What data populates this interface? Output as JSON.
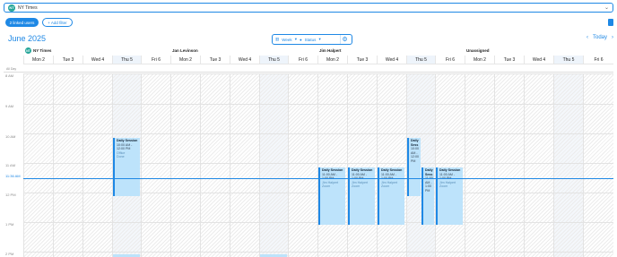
{
  "topbar": {
    "avatar": "NT",
    "label": "NY Times"
  },
  "toolbar": {
    "primary": "2 linked users",
    "secondary": "+ Add filter"
  },
  "header": {
    "month": "June 2025",
    "view": "Week",
    "status": "Status",
    "today": "Today",
    "prev": "‹",
    "next": "›"
  },
  "allday_label": "All Day",
  "resources": [
    {
      "name": "NY Times",
      "avatar": "NT"
    },
    {
      "name": "Jan Levinson",
      "avatar": ""
    },
    {
      "name": "Jim Halpert",
      "avatar": ""
    },
    {
      "name": "Unassigned",
      "avatar": ""
    }
  ],
  "days": [
    "Mon  2",
    "Tue  3",
    "Wed  4",
    "Thu  5",
    "Fri  6"
  ],
  "times": [
    "8 AM",
    "9 AM",
    "10 AM",
    "11 AM",
    "12 PM",
    "1 PM",
    "2 PM"
  ],
  "now_label": "11:36 AM",
  "events": [
    {
      "title": "Daily Session",
      "time": "10:00 AM - 12:00 PM",
      "loc": "Office",
      "tag": "Done"
    },
    {
      "title": "Daily Session",
      "time": "11:00 AM - 1:00 PM",
      "loc": "Jim Halpert",
      "tag": "Zoom"
    },
    {
      "title": "Daily Session",
      "time": "11:00 AM - 1:00 PM",
      "loc": "Jim Halpert",
      "tag": "Zoom"
    },
    {
      "title": "Daily Session",
      "time": "11:00 AM - 1:00 PM",
      "loc": "Jim Halpert",
      "tag": "Zoom"
    },
    {
      "title": "Daily Sess",
      "time": "10:00 AM - 12:00 PM",
      "loc": "",
      "tag": ""
    },
    {
      "title": "Daily Sess",
      "time": "11:00 AM - 1:00 PM",
      "loc": "",
      "tag": ""
    },
    {
      "title": "Daily Session",
      "time": "11:00 AM - 1:00 PM",
      "loc": "Jim Halpert",
      "tag": "Zoom"
    }
  ],
  "colors": {
    "accent": "#1e88e5",
    "event_bg": "#bde3fb",
    "avatar": "#26a69a"
  }
}
